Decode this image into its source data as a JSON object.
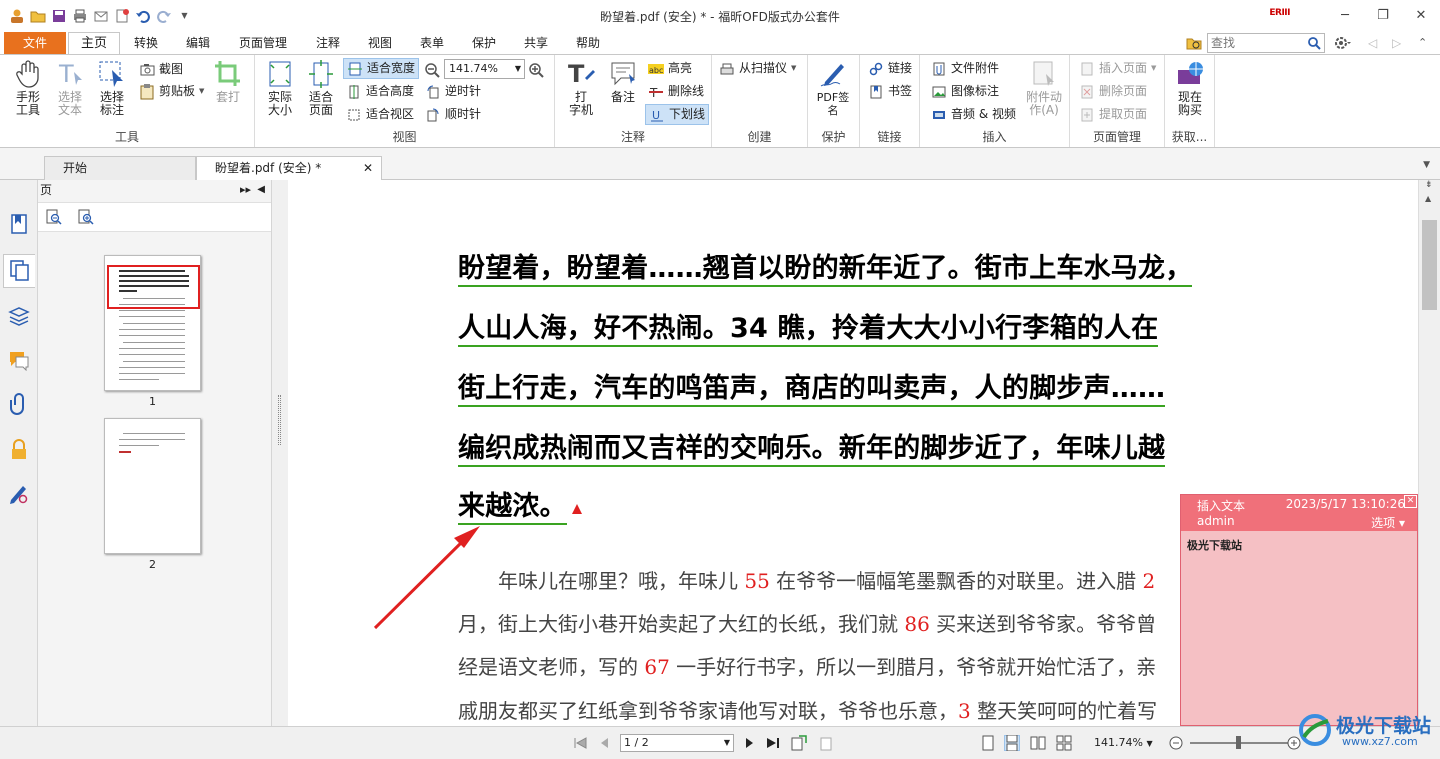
{
  "window": {
    "title": "盼望着.pdf (安全) * - 福昕OFD版式办公套件",
    "minimize": "─",
    "restore": "❐",
    "close": "✕",
    "logo": "ERIII"
  },
  "menu": {
    "file": "文件",
    "tabs": [
      "主页",
      "转换",
      "编辑",
      "页面管理",
      "注释",
      "视图",
      "表单",
      "保护",
      "共享",
      "帮助"
    ],
    "search_placeholder": "查找"
  },
  "ribbon": {
    "tools": {
      "label": "工具",
      "hand": "手形\n工具",
      "select_text": "选择\n文本",
      "select_annot": "选择\n标注",
      "snapshot": "截图",
      "clipboard": "剪贴板",
      "crop": "套打"
    },
    "view": {
      "label": "视图",
      "actual_size": "实际\n大小",
      "fit_page": "适合\n页面",
      "fit_width": "适合宽度",
      "fit_height": "适合高度",
      "fit_visible": "适合视区",
      "zoom_value": "141.74%",
      "rotate_ccw": "逆时针",
      "rotate_cw": "顺时针"
    },
    "comment": {
      "label": "注释",
      "typewriter": "打\n字机",
      "note": "备注",
      "highlight": "高亮",
      "strikeout": "删除线",
      "underline": "下划线"
    },
    "create": {
      "label": "创建",
      "from_scanner": "从扫描仪"
    },
    "protect": {
      "label": "保护",
      "pdf_sign": "PDF签\n名"
    },
    "link": {
      "label": "链接",
      "link": "链接",
      "bookmark": "书签"
    },
    "insert": {
      "label": "插入",
      "file_attachment": "文件附件",
      "image_annot": "图像标注",
      "audio_video": "音频 & 视频",
      "attach_action": "附件动\n作(A)"
    },
    "pages": {
      "label": "页面管理",
      "insert_page": "插入页面",
      "delete_page": "删除页面",
      "extract_page": "提取页面"
    },
    "buy": {
      "label": "获取...",
      "buy_now": "现在\n购买"
    }
  },
  "doc_tabs": [
    {
      "label": "开始",
      "active": false
    },
    {
      "label": "盼望着.pdf (安全) *",
      "active": true
    }
  ],
  "thumb_panel": {
    "title": "页",
    "pages": [
      "1",
      "2"
    ]
  },
  "document": {
    "highlighted_lines": [
      "盼望着，盼望着……翘首以盼的新年近了。街市上车水马龙，",
      "人山人海，好不热闹。34 瞧，拎着大大小小行李箱的人在",
      "街上行走，汽车的鸣笛声，商店的叫卖声，人的脚步声……",
      "编织成热闹而又吉祥的交响乐。新年的脚步近了，年味儿越",
      "来越浓。"
    ],
    "body_lines": [
      [
        {
          "t": "　　年味儿在哪里？哦，年味儿 "
        },
        {
          "t": "55",
          "red": true
        },
        {
          "t": " 在爷爷一幅幅笔墨飘香的对联里。进入腊 "
        },
        {
          "t": "2",
          "red": true
        }
      ],
      [
        {
          "t": "月，街上大街小巷开始卖起了大红的长纸，我们就 "
        },
        {
          "t": "86",
          "red": true
        },
        {
          "t": " 买来送到爷爷家。爷爷曾"
        }
      ],
      [
        {
          "t": "经是语文老师，写的 "
        },
        {
          "t": "67",
          "red": true
        },
        {
          "t": " 一手好行书字，所以一到腊月，爷爷就开始忙活了，亲"
        }
      ],
      [
        {
          "t": "戚朋友都买了红纸拿到爷爷家请他写对联，爷爷也乐意，"
        },
        {
          "t": "3",
          "red": true
        },
        {
          "t": " 整天笑呵呵的忙着写"
        }
      ]
    ]
  },
  "popup": {
    "title": "插入文本",
    "timestamp": "2023/5/17 13:10:26",
    "author": "admin",
    "options": "选项",
    "content": "极光下载站"
  },
  "status": {
    "page": "1 / 2",
    "zoom": "141.74%"
  },
  "watermark": {
    "name": "极光下载站",
    "url": "www.xz7.com"
  },
  "colors": {
    "file_tab": "#e8711e",
    "underline": "#3aa321",
    "red_number": "#e02020",
    "popup_header": "#f0707a",
    "popup_body": "#f5c0c4",
    "arrow": "#e02020"
  }
}
